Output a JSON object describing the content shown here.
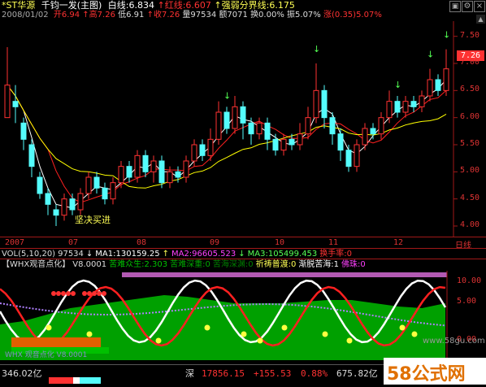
{
  "colors": {
    "bg": "#000000",
    "up": "#ff3232",
    "down": "#54fcfc",
    "ma_white": "#ffffff",
    "ma_yellow": "#ffff00",
    "ma_red": "#ff2020",
    "axis": "#a01818",
    "green": "#00a800",
    "magenta": "#ff40ff"
  },
  "header": {
    "stock": "*ST华源",
    "title": "千钧一发(主图)",
    "white_line": "白线:6.834",
    "red_line": "红线:6.607",
    "strength_line": "强弱分界线:6.175",
    "date": "2008/01/02",
    "open": "开6.94",
    "high": "高7.26",
    "low": "低6.91",
    "close": "收7.26",
    "volume": "量97534",
    "amount": "额7071",
    "turnover": "换0.00%",
    "amplitude": "振5.07%",
    "change": "涨(0.35)5.07%"
  },
  "icons": {
    "up_arrow": "up-arrow-icon",
    "settings": "gear-icon",
    "close": "close-icon",
    "scroll_up": "chevron-up-icon",
    "scroll_down": "chevron-down-icon",
    "period": "period-icon"
  },
  "main_chart": {
    "y_ticks": [
      "7.50",
      "7.00",
      "6.50",
      "6.00",
      "5.50",
      "5.00",
      "4.50",
      "4.00"
    ],
    "price_badge": "7.26",
    "annotation": "坚决买进",
    "x_labels": [
      "2007",
      "07",
      "08",
      "09",
      "10",
      "11",
      "12",
      "日线"
    ]
  },
  "volume_bar": {
    "label": "VOL(5,10,20)",
    "vol": "97534",
    "ma1": "MA1:130159.25",
    "ma2": "MA2:96605.523",
    "ma3": "MA3:105499.453",
    "turnover": "换手率:0"
  },
  "indicator": {
    "name": "【WHX观音点化】",
    "version": "V8.0001",
    "l1": "苦难众生:2.303",
    "l2": "苦难深重:0",
    "l3": "苦海深渊:0",
    "l4": "祈祷普渡:0",
    "l5": "渐脱苦海:1",
    "l6": "佛珠:0",
    "y_ticks": [
      "10.00",
      "5.00",
      "0.00"
    ],
    "footer": "WHX 观音点化 V8.0001"
  },
  "watermark": "www.58gu.com",
  "logo": "58公式网",
  "status_bar": {
    "index_a": "346.02亿",
    "index_b": "深",
    "index_b_val": "17856.15",
    "index_b_chg": "+155.53",
    "index_b_pct": "0.88%",
    "index_b_amt": "675.82亿"
  },
  "chart_data": {
    "type": "candlestick",
    "period": "日线",
    "ylim": [
      3.85,
      7.75
    ],
    "x_months": [
      "2007",
      "07",
      "08",
      "09",
      "10",
      "11",
      "12"
    ],
    "candles": [
      [
        6.0,
        6.6,
        7.3,
        6.0
      ],
      [
        6.3,
        6.2,
        6.6,
        5.9
      ],
      [
        5.9,
        5.6,
        6.0,
        5.4
      ],
      [
        5.5,
        5.1,
        5.6,
        4.9
      ],
      [
        4.9,
        4.6,
        5.0,
        4.5
      ],
      [
        4.6,
        4.4,
        4.7,
        4.2
      ],
      [
        4.3,
        4.2,
        4.4,
        4.0
      ],
      [
        4.2,
        4.5,
        4.6,
        4.1
      ],
      [
        4.5,
        4.3,
        4.6,
        4.2
      ],
      [
        4.3,
        4.6,
        4.7,
        4.2
      ],
      [
        4.6,
        4.9,
        5.0,
        4.5
      ],
      [
        4.9,
        4.7,
        5.0,
        4.6
      ],
      [
        4.7,
        4.5,
        4.8,
        4.4
      ],
      [
        4.5,
        4.8,
        4.9,
        4.4
      ],
      [
        4.8,
        5.1,
        5.2,
        4.7
      ],
      [
        5.1,
        4.9,
        5.2,
        4.8
      ],
      [
        4.9,
        5.3,
        5.4,
        4.8
      ],
      [
        5.3,
        5.0,
        5.4,
        4.9
      ],
      [
        5.0,
        5.2,
        5.3,
        4.8
      ],
      [
        5.2,
        4.8,
        5.3,
        4.7
      ],
      [
        4.8,
        5.0,
        5.1,
        4.7
      ],
      [
        5.0,
        4.9,
        5.1,
        4.8
      ],
      [
        4.9,
        5.2,
        5.3,
        4.8
      ],
      [
        5.2,
        5.5,
        5.6,
        5.1
      ],
      [
        5.5,
        5.3,
        5.6,
        5.2
      ],
      [
        5.3,
        5.6,
        5.8,
        5.2
      ],
      [
        5.6,
        6.1,
        6.3,
        5.5
      ],
      [
        6.1,
        5.8,
        6.2,
        5.7
      ],
      [
        5.8,
        6.2,
        6.4,
        5.7
      ],
      [
        6.2,
        5.9,
        6.3,
        5.6
      ],
      [
        5.9,
        5.7,
        6.0,
        5.5
      ],
      [
        5.7,
        5.9,
        6.0,
        5.6
      ],
      [
        5.9,
        5.6,
        6.0,
        5.4
      ],
      [
        5.6,
        5.4,
        5.7,
        5.3
      ],
      [
        5.4,
        5.6,
        5.7,
        5.3
      ],
      [
        5.6,
        5.5,
        5.7,
        5.4
      ],
      [
        5.5,
        5.7,
        5.9,
        5.4
      ],
      [
        5.7,
        6.0,
        6.2,
        5.6
      ],
      [
        6.0,
        6.5,
        7.0,
        5.9
      ],
      [
        6.5,
        6.0,
        6.6,
        5.8
      ],
      [
        6.0,
        5.7,
        6.1,
        5.5
      ],
      [
        5.7,
        5.4,
        5.8,
        5.2
      ],
      [
        5.4,
        5.1,
        5.5,
        5.0
      ],
      [
        5.1,
        5.5,
        5.6,
        5.0
      ],
      [
        5.5,
        5.8,
        5.9,
        5.4
      ],
      [
        5.8,
        5.7,
        5.9,
        5.6
      ],
      [
        5.7,
        6.0,
        6.1,
        5.6
      ],
      [
        6.0,
        6.3,
        6.5,
        5.9
      ],
      [
        6.3,
        6.1,
        6.4,
        6.0
      ],
      [
        6.1,
        6.3,
        6.4,
        6.0
      ],
      [
        6.3,
        6.2,
        6.4,
        6.1
      ],
      [
        6.2,
        6.4,
        6.5,
        6.1
      ],
      [
        6.4,
        6.7,
        6.9,
        6.3
      ],
      [
        6.7,
        6.5,
        6.8,
        6.4
      ],
      [
        6.5,
        6.9,
        7.26,
        6.4
      ]
    ]
  }
}
